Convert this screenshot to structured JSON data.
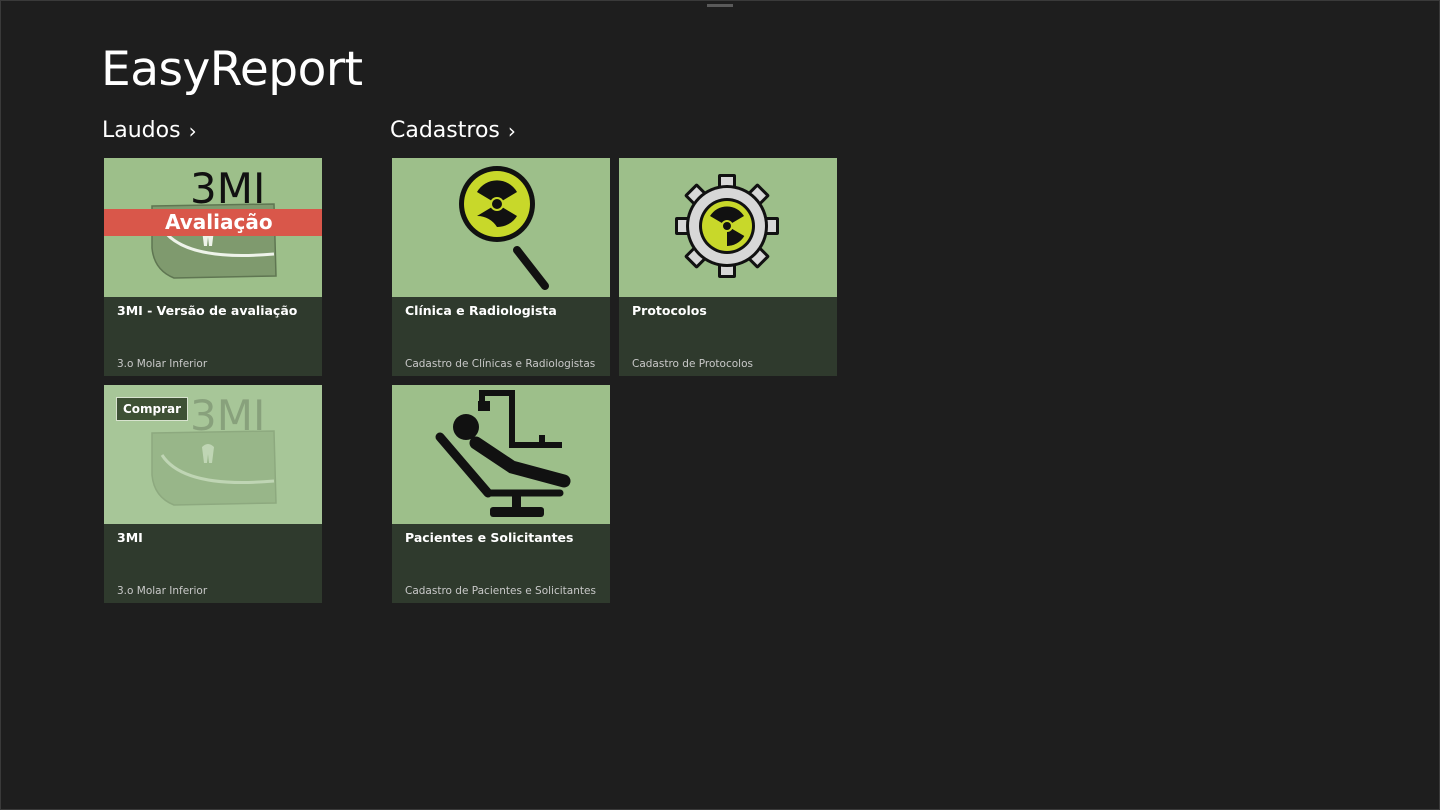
{
  "app": {
    "title": "EasyReport"
  },
  "groups": [
    {
      "label": "Laudos",
      "chevron": "›"
    },
    {
      "label": "Cadastros",
      "chevron": "›"
    }
  ],
  "tiles": [
    {
      "title": "3MI - Versão de avaliação",
      "subtitle": "3.o Molar Inferior",
      "image_text": "3MI",
      "banner": "Avaliação",
      "icon": "tooth-jaw-icon"
    },
    {
      "title": "3MI",
      "subtitle": "3.o Molar Inferior",
      "image_text": "3MI",
      "button": "Comprar",
      "icon": "tooth-jaw-icon"
    },
    {
      "title": "Clínica e Radiologista",
      "subtitle": "Cadastro de Clínicas e Radiologistas",
      "icon": "magnifier-radiation-icon"
    },
    {
      "title": "Protocolos",
      "subtitle": "Cadastro de Protocolos",
      "icon": "gear-radiation-icon"
    },
    {
      "title": "Pacientes e Solicitantes",
      "subtitle": "Cadastro de Pacientes e Solicitantes",
      "icon": "dental-chair-icon"
    }
  ],
  "colors": {
    "background": "#1e1e1e",
    "tile_image": "#9dbf8a",
    "tile_caption": "#2f3a2d",
    "banner": "#d9574a",
    "radiation": "#c8d82a"
  }
}
